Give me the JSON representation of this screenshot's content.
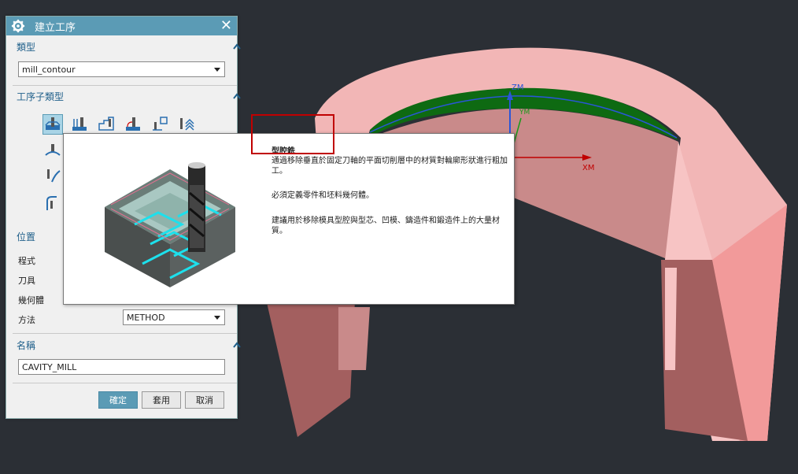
{
  "dialog": {
    "title": "建立工序",
    "icons": {
      "gear": "gear-icon",
      "close": "close-icon"
    },
    "type_section": {
      "label": "類型",
      "value": "mill_contour"
    },
    "subtype_section": {
      "label": "工序子類型"
    },
    "location_section": {
      "label": "位置",
      "fields": [
        {
          "label": "程式",
          "value": ""
        },
        {
          "label": "刀具",
          "value": ""
        },
        {
          "label": "幾何體",
          "value": ""
        },
        {
          "label": "方法",
          "value": "METHOD"
        }
      ]
    },
    "name_section": {
      "label": "名稱",
      "value": "CAVITY_MILL"
    },
    "buttons": {
      "ok": "確定",
      "apply": "套用",
      "cancel": "取消"
    }
  },
  "tooltip": {
    "title": "型腔銑",
    "line1": "通過移除垂直於固定刀軸的平面切削層中的材質對輪廓形狀進行粗加",
    "line1b": "工。",
    "line2": "必須定義零件和坯料幾何體。",
    "line3": "建議用於移除模具型腔與型芯、凹模、鑄造件和鍛造件上的大量材",
    "line3b": "質。"
  },
  "viewport": {
    "axis_z": "ZM",
    "axis_x": "XM",
    "axis_y": "YM",
    "colors": {
      "background": "#2b2f35",
      "part": "#f2b6b6",
      "part_shade": "#a35f5f",
      "floor": "#0e6a12"
    }
  }
}
